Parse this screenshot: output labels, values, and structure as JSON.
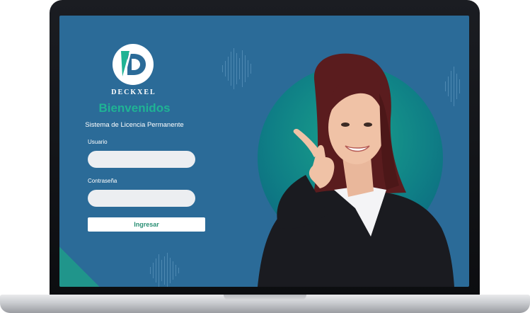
{
  "app": {
    "brand": "DECKXEL",
    "welcome": "Bienvenidos",
    "subtitle": "Sistema de Licencia Permanente"
  },
  "form": {
    "username": {
      "label": "Usuario",
      "value": "",
      "placeholder": ""
    },
    "password": {
      "label": "Contraseña",
      "value": "",
      "placeholder": ""
    },
    "submit_label": "Ingresar"
  },
  "colors": {
    "screen_bg": "#2b6b98",
    "accent_green": "#1fb394",
    "button_text": "#2a8f74",
    "input_bg": "#eceef1"
  },
  "icons": {
    "logo": "deckxel-logo-icon",
    "hero": "woman-pointing-photo"
  }
}
